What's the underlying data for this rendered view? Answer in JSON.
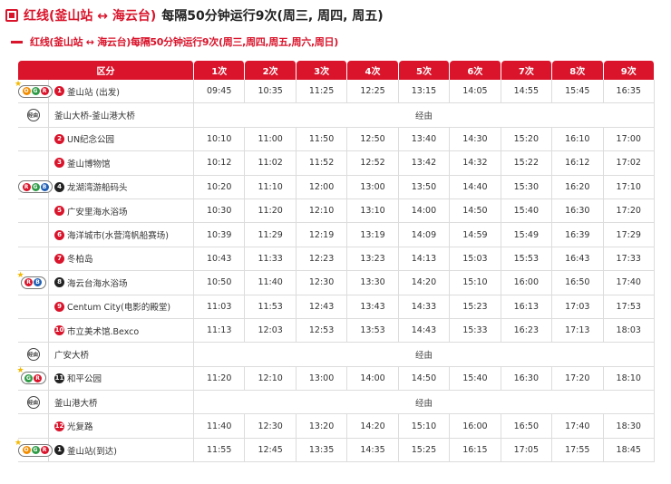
{
  "header": {
    "title_route": "红线(釜山站 ↔ 海云台)",
    "title_rest": "每隔50分钟运行9次(周三, 周四, 周五)"
  },
  "subheader": {
    "text": "红线(釜山站 ↔ 海云台)每隔50分钟运行9次(周三,周四,周五,周六,周日)"
  },
  "table": {
    "section_header": "区分",
    "run_headers": [
      "1次",
      "2次",
      "3次",
      "4次",
      "5次",
      "6次",
      "7次",
      "8次",
      "9次"
    ],
    "via_text": "经由",
    "via_badge": "经由",
    "rows": [
      {
        "badge": [
          "O",
          "G",
          "R"
        ],
        "star": true,
        "num": "1",
        "name": "釜山站 (出发)",
        "times": [
          "09:45",
          "10:35",
          "11:25",
          "12:25",
          "13:15",
          "14:05",
          "14:55",
          "15:45",
          "16:35"
        ]
      },
      {
        "via": true,
        "name": "釜山大桥-釜山港大桥"
      },
      {
        "num": "2",
        "name": "UN纪念公园",
        "times": [
          "10:10",
          "11:00",
          "11:50",
          "12:50",
          "13:40",
          "14:30",
          "15:20",
          "16:10",
          "17:00"
        ]
      },
      {
        "num": "3",
        "name": "釜山博物馆",
        "times": [
          "10:12",
          "11:02",
          "11:52",
          "12:52",
          "13:42",
          "14:32",
          "15:22",
          "16:12",
          "17:02"
        ]
      },
      {
        "badge": [
          "R",
          "G",
          "B"
        ],
        "star": false,
        "num": "4",
        "dark": true,
        "name": "龙湖湾游船码头",
        "times": [
          "10:20",
          "11:10",
          "12:00",
          "13:00",
          "13:50",
          "14:40",
          "15:30",
          "16:20",
          "17:10"
        ]
      },
      {
        "num": "5",
        "name": "广安里海水浴场",
        "times": [
          "10:30",
          "11:20",
          "12:10",
          "13:10",
          "14:00",
          "14:50",
          "15:40",
          "16:30",
          "17:20"
        ]
      },
      {
        "num": "6",
        "name": "海洋城市(水营湾帆船赛场)",
        "times": [
          "10:39",
          "11:29",
          "12:19",
          "13:19",
          "14:09",
          "14:59",
          "15:49",
          "16:39",
          "17:29"
        ]
      },
      {
        "num": "7",
        "name": "冬柏岛",
        "times": [
          "10:43",
          "11:33",
          "12:23",
          "13:23",
          "14:13",
          "15:03",
          "15:53",
          "16:43",
          "17:33"
        ]
      },
      {
        "badge": [
          "R",
          "B"
        ],
        "star": true,
        "num": "8",
        "dark": true,
        "name": "海云台海水浴场",
        "times": [
          "10:50",
          "11:40",
          "12:30",
          "13:30",
          "14:20",
          "15:10",
          "16:00",
          "16:50",
          "17:40"
        ]
      },
      {
        "num": "9",
        "name": "Centum City(电影的殿堂)",
        "times": [
          "11:03",
          "11:53",
          "12:43",
          "13:43",
          "14:33",
          "15:23",
          "16:13",
          "17:03",
          "17:53"
        ]
      },
      {
        "num": "10",
        "name": "市立美术馆.Bexco",
        "times": [
          "11:13",
          "12:03",
          "12:53",
          "13:53",
          "14:43",
          "15:33",
          "16:23",
          "17:13",
          "18:03"
        ]
      },
      {
        "via": true,
        "name": "广安大桥"
      },
      {
        "badge": [
          "G",
          "R"
        ],
        "star": true,
        "num": "11",
        "dark": true,
        "name": "和平公园",
        "times": [
          "11:20",
          "12:10",
          "13:00",
          "14:00",
          "14:50",
          "15:40",
          "16:30",
          "17:20",
          "18:10"
        ]
      },
      {
        "via": true,
        "name": "釜山港大桥"
      },
      {
        "num": "12",
        "name": "光复路",
        "times": [
          "11:40",
          "12:30",
          "13:20",
          "14:20",
          "15:10",
          "16:00",
          "16:50",
          "17:40",
          "18:30"
        ]
      },
      {
        "badge": [
          "O",
          "G",
          "R"
        ],
        "star": true,
        "num": "1",
        "dark": true,
        "name": "釜山站(到达)",
        "times": [
          "11:55",
          "12:45",
          "13:35",
          "14:35",
          "15:25",
          "16:15",
          "17:05",
          "17:55",
          "18:45"
        ]
      }
    ]
  },
  "colors": {
    "accent": "#d9142b",
    "orange": "#f28c00",
    "green": "#2e9c46",
    "blue": "#1f5fb5",
    "star": "#f3b800"
  }
}
